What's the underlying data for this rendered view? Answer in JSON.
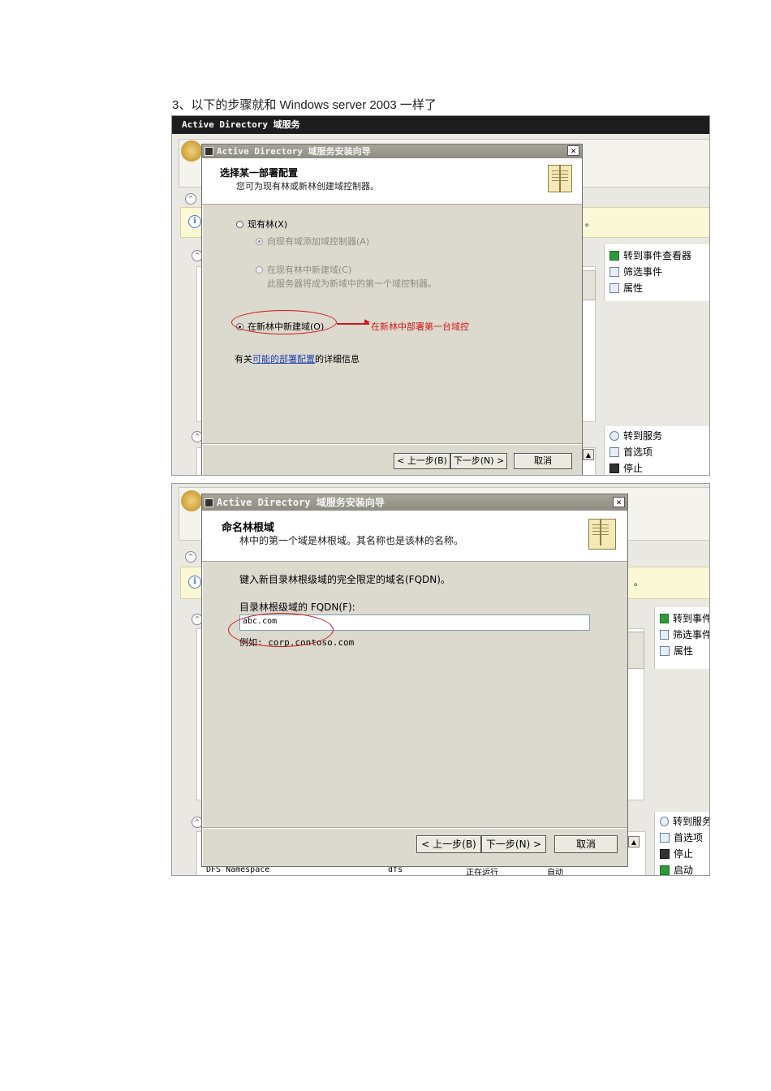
{
  "heading": "3、以下的步骤就和 Windows server 2003 一样了",
  "shot1": {
    "window_title": "Active Directory 域服务",
    "dialog_title": "Active Directory 域服务安装向导",
    "close_glyph": "✕",
    "header_title": "选择某一部署配置",
    "header_subtitle": "您可为现有林或新林创建域控制器。",
    "options": [
      {
        "label": "现有林(X)",
        "selected": false,
        "disabled": false
      },
      {
        "label": "向现有域添加域控制器(A)",
        "selected": true,
        "disabled": true
      },
      {
        "label": "在现有林中新建域(C)",
        "selected": false,
        "disabled": true
      },
      {
        "label": "此服务器将成为新域中的第一个域控制器。",
        "selected": false,
        "disabled": true
      },
      {
        "label": "在新林中新建域(O)",
        "selected": true,
        "disabled": false
      }
    ],
    "annotation": "在新林中部署第一台域控",
    "info_prefix": "有关",
    "info_link": "可能的部署配置",
    "info_suffix": "的详细信息",
    "buttons": {
      "back": "< 上一步(B)",
      "next": "下一步(N) >",
      "cancel": "取消"
    },
    "info_bar_tail": "。",
    "actions_top": [
      "转到事件查看器",
      "筛选事件",
      "属性"
    ],
    "actions_bottom": [
      "转到服务",
      "首选项",
      "停止"
    ]
  },
  "shot2": {
    "dialog_title": "Active Directory 域服务安装向导",
    "close_glyph": "✕",
    "header_title": "命名林根域",
    "header_subtitle": "林中的第一个域是林根域。其名称也是该林的名称。",
    "instruction": "键入新目录林根级域的完全限定的域名(FQDN)。",
    "field_label": "目录林根级域的 FQDN(F):",
    "field_value": "abc.com",
    "example": "例如: corp.contoso.com",
    "buttons": {
      "back": "< 上一步(B)",
      "next": "下一步(N) >",
      "cancel": "取消"
    },
    "info_bar_tail": "。",
    "actions_top": [
      "转到事件",
      "筛选事件",
      "属性"
    ],
    "actions_bottom": [
      "转到服务",
      "首选项",
      "停止",
      "启动"
    ],
    "bottom_row": {
      "name": "DFS Namespace",
      "short": "dfs",
      "status": "正在运行",
      "startup": "自动"
    }
  },
  "colors": {
    "annotation_red": "#d21616",
    "link_blue": "#1c3fb0"
  }
}
